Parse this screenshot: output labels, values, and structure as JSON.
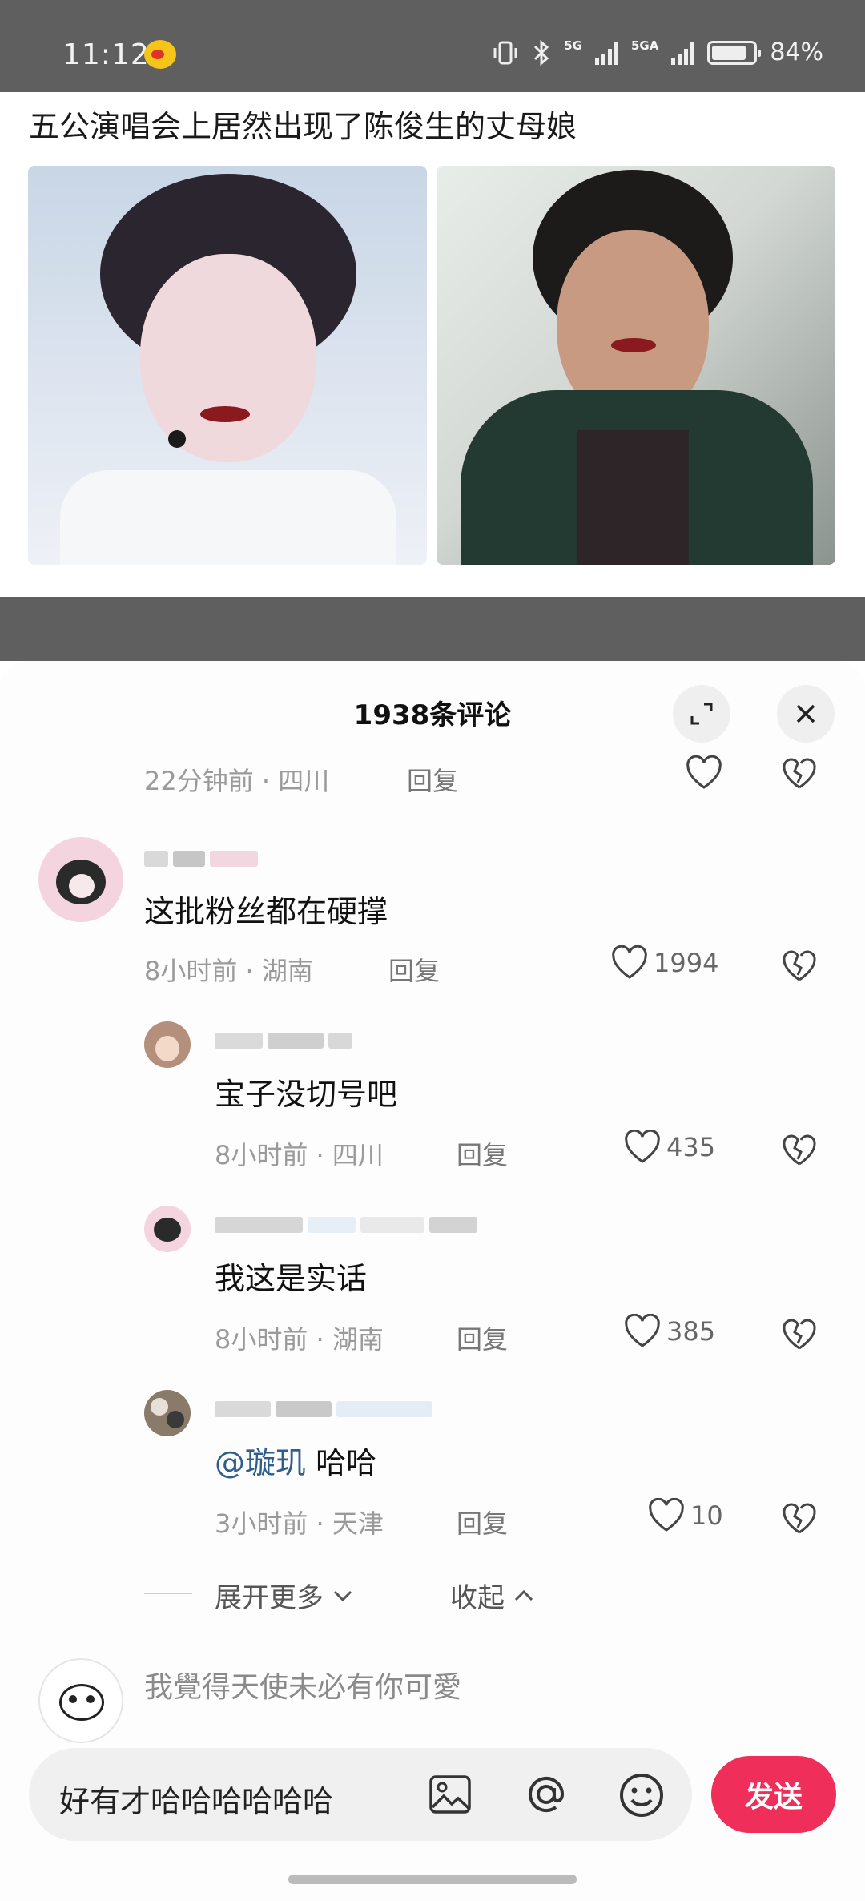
{
  "status_bar": {
    "time": "11:12",
    "network_1": "5G",
    "network_2": "5GA",
    "battery_percent": 84,
    "battery_label": "84%"
  },
  "post": {
    "title": "五公演唱会上居然出现了陈俊生的丈母娘"
  },
  "comments_panel": {
    "title": "1938条评论",
    "reply_label": "回复",
    "top_meta": "22分钟前 · 四川",
    "comments": [
      {
        "text": "这批粉丝都在硬撑",
        "meta": "8小时前 · 湖南",
        "likes": "1994"
      }
    ],
    "replies": [
      {
        "text": "宝子没切号吧",
        "meta": "8小时前 · 四川",
        "likes": "435"
      },
      {
        "text": "我这是实话",
        "meta": "8小时前 · 湖南",
        "likes": "385"
      },
      {
        "mention": "@璇玑",
        "text": " 哈哈",
        "meta": "3小时前 · 天津",
        "likes": "10"
      }
    ],
    "expand_more": "展开更多",
    "collapse": "收起",
    "next_comment_text": "我覺得天使未必有你可愛"
  },
  "input_bar": {
    "value": "好有才哈哈哈哈哈哈",
    "send_label": "发送"
  },
  "colors": {
    "accent": "#ef2f5a",
    "mention": "#2f5d8c",
    "status_bar": "#5f5f5f"
  }
}
